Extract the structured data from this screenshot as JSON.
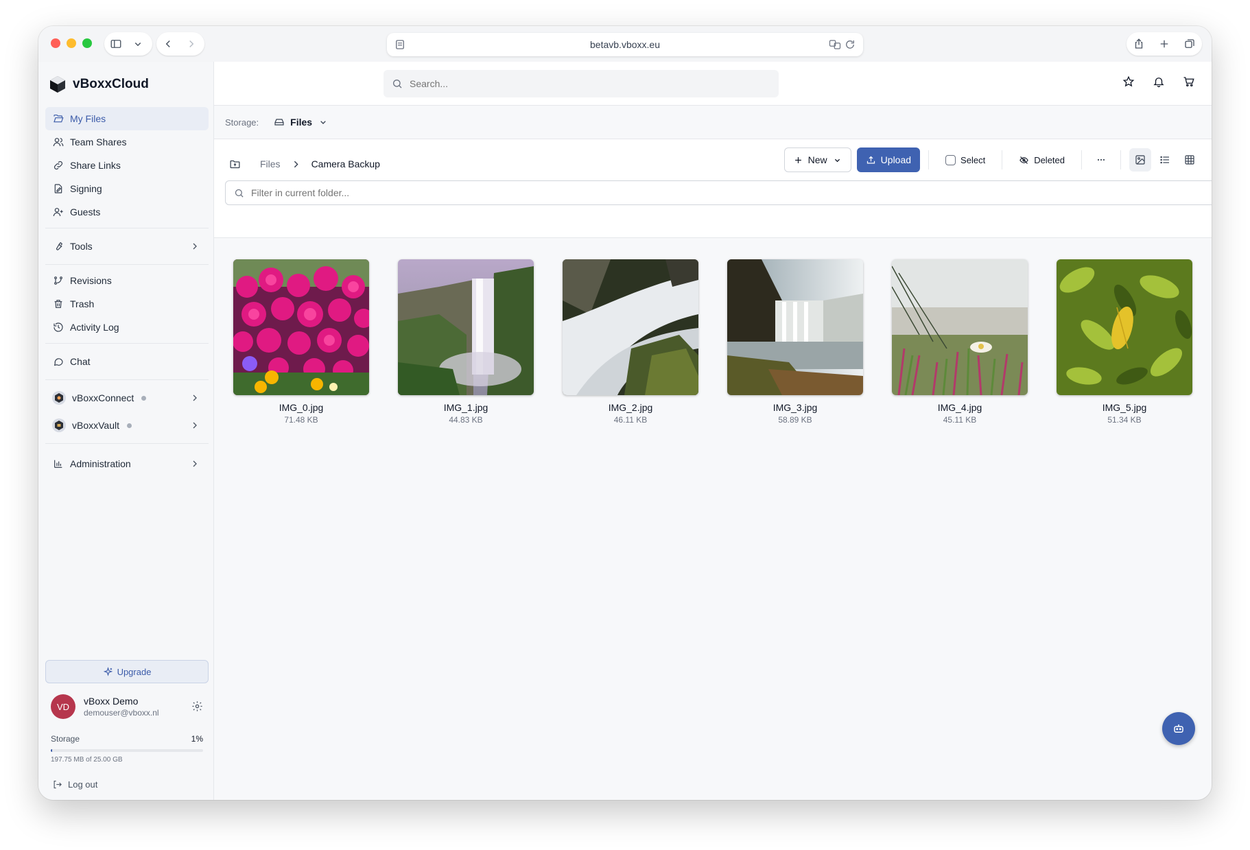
{
  "browser": {
    "url": "betavb.vboxx.eu"
  },
  "app": {
    "name": "vBoxxCloud"
  },
  "sidebar": {
    "nav1": [
      {
        "label": "My Files",
        "icon": "folder-open-icon"
      },
      {
        "label": "Team Shares",
        "icon": "users-icon"
      },
      {
        "label": "Share Links",
        "icon": "link-icon"
      },
      {
        "label": "Signing",
        "icon": "signature-icon"
      },
      {
        "label": "Guests",
        "icon": "user-plus-icon"
      }
    ],
    "tools_label": "Tools",
    "nav2": [
      {
        "label": "Revisions",
        "icon": "git-branch-icon"
      },
      {
        "label": "Trash",
        "icon": "trash-icon"
      },
      {
        "label": "Activity Log",
        "icon": "history-icon"
      }
    ],
    "chat_label": "Chat",
    "apps": [
      {
        "label": "vBoxxConnect"
      },
      {
        "label": "vBoxxVault"
      }
    ],
    "admin_label": "Administration",
    "upgrade_label": "Upgrade",
    "user": {
      "initials": "VD",
      "name": "vBoxx Demo",
      "email": "demouser@vboxx.nl"
    },
    "storage": {
      "label": "Storage",
      "percent_text": "1%",
      "percent": 1,
      "detail": "197.75 MB of 25.00 GB"
    },
    "logout_label": "Log out"
  },
  "topbar": {
    "search_placeholder": "Search..."
  },
  "storage_selector": {
    "caption": "Storage:",
    "value": "Files"
  },
  "breadcrumb": {
    "root": "Files",
    "current": "Camera Backup"
  },
  "toolbar": {
    "new_label": "New",
    "upload_label": "Upload",
    "select_label": "Select",
    "deleted_label": "Deleted"
  },
  "filter": {
    "placeholder": "Filter in current folder..."
  },
  "files": [
    {
      "name": "IMG_0.jpg",
      "size": "71.48 KB"
    },
    {
      "name": "IMG_1.jpg",
      "size": "44.83 KB"
    },
    {
      "name": "IMG_2.jpg",
      "size": "46.11 KB"
    },
    {
      "name": "IMG_3.jpg",
      "size": "58.89 KB"
    },
    {
      "name": "IMG_4.jpg",
      "size": "45.11 KB"
    },
    {
      "name": "IMG_5.jpg",
      "size": "51.34 KB"
    }
  ],
  "colors": {
    "accent": "#3f62b1",
    "avatar": "#b6364d"
  }
}
